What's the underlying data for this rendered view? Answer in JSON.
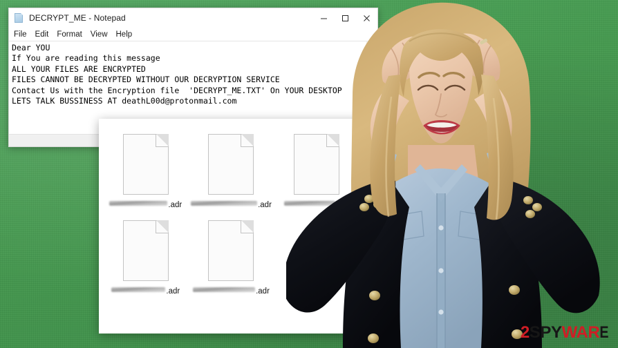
{
  "background": {
    "description": "green-textured-wall",
    "color": "#45994f"
  },
  "notepad": {
    "title": "DECRYPT_ME - Notepad",
    "icon": "notepad-document-icon",
    "menu": [
      "File",
      "Edit",
      "Format",
      "View",
      "Help"
    ],
    "window_controls": {
      "minimize": "minimize-button",
      "maximize": "maximize-button",
      "close": "close-button"
    },
    "scrollbar": {
      "up_arrow": "scroll-up-arrow"
    },
    "ransom_note_lines": [
      "Dear YOU",
      "If You are reading this message",
      "ALL YOUR FILES ARE ENCRYPTED",
      "FILES CANNOT BE DECRYPTED WITHOUT OUR DECRYPTION SERVICE",
      "Contact Us with the Encryption file  'DECRYPT_ME.TXT' On YOUR DESKTOP",
      "LETS TALK BUSSINESS AT deathL00d@protonmail.com"
    ],
    "ransom_note_text": "Dear YOU\nIf You are reading this message\nALL YOUR FILES ARE ENCRYPTED\nFILES CANNOT BE DECRYPTED WITHOUT OUR DECRYPTION SERVICE\nContact Us with the Encryption file  'DECRYPT_ME.TXT' On YOUR DESKTOP\nLETS TALK BUSSINESS AT deathL00d@protonmail.com",
    "contact_email": "deathL00d@protonmail.com",
    "note_filename": "DECRYPT_ME.TXT"
  },
  "explorer": {
    "files": [
      {
        "name_redacted": true,
        "redacted_width": 84,
        "extension": ".adr"
      },
      {
        "name_redacted": true,
        "redacted_width": 96,
        "extension": ".adr"
      },
      {
        "name_redacted": true,
        "redacted_width": 74,
        "extension": ".adr"
      },
      {
        "name_redacted": true,
        "redacted_width": 78,
        "extension": ".adr"
      },
      {
        "name_redacted": true,
        "redacted_width": 90,
        "extension": ".adr"
      }
    ],
    "encrypted_extension": ".adr",
    "file_icon": "blank-document-icon"
  },
  "photo": {
    "subject": "frustrated-woman-hands-on-head",
    "clothing": "black-blazer-gold-buttons-denim-shirt",
    "hair": "long-blonde-hair"
  },
  "watermark": {
    "part_number": "2",
    "part_spy": "SPY",
    "part_war": "WAR",
    "part_e": "E",
    "full_text": "2SPYWARE",
    "color_red": "#cf1d25",
    "color_dark": "#161616"
  }
}
